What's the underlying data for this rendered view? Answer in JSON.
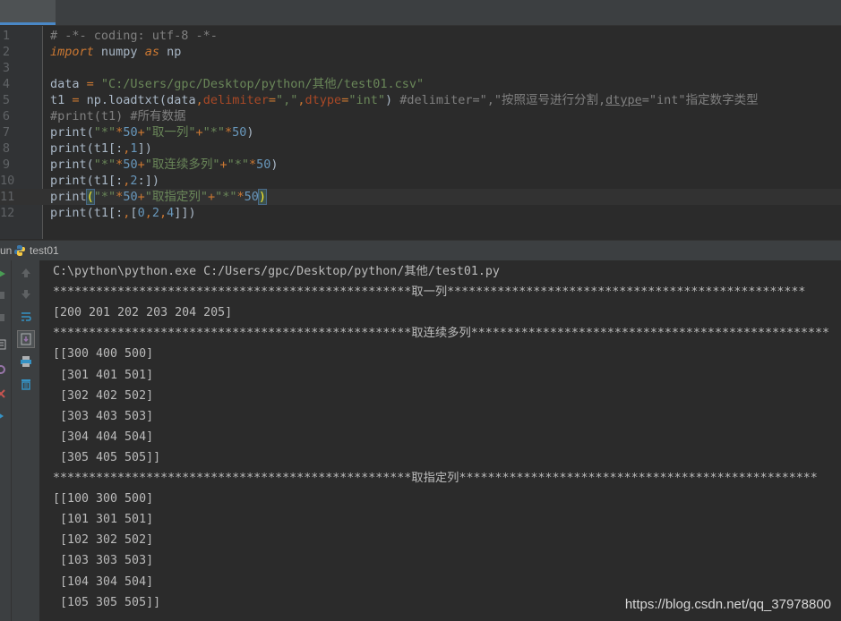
{
  "editor": {
    "lines": [
      {
        "n": "1",
        "segs": [
          {
            "c": "cm",
            "t": "# -*- coding: utf-8 -*-"
          }
        ]
      },
      {
        "n": "2",
        "segs": [
          {
            "c": "kw",
            "t": "import"
          },
          {
            "c": "fn",
            "t": " numpy "
          },
          {
            "c": "kw",
            "t": "as"
          },
          {
            "c": "fn",
            "t": " np"
          }
        ]
      },
      {
        "n": "3",
        "segs": []
      },
      {
        "n": "4",
        "segs": [
          {
            "c": "fn",
            "t": "data "
          },
          {
            "c": "op",
            "t": "="
          },
          {
            "c": "fn",
            "t": " "
          },
          {
            "c": "str",
            "t": "\"C:/Users/gpc/Desktop/python/其他/test01.csv\""
          }
        ]
      },
      {
        "n": "5",
        "segs": [
          {
            "c": "fn",
            "t": "t1 "
          },
          {
            "c": "op",
            "t": "="
          },
          {
            "c": "fn",
            "t": " np.loadtxt(data"
          },
          {
            "c": "op",
            "t": ","
          },
          {
            "c": "param",
            "t": "delimiter"
          },
          {
            "c": "op",
            "t": "="
          },
          {
            "c": "str",
            "t": "\",\""
          },
          {
            "c": "op",
            "t": ","
          },
          {
            "c": "param",
            "t": "dtype"
          },
          {
            "c": "op",
            "t": "="
          },
          {
            "c": "str",
            "t": "\"int\""
          },
          {
            "c": "fn",
            "t": ") "
          },
          {
            "c": "cm",
            "t": "#delimiter=\",\"按照逗号进行分割,"
          },
          {
            "c": "cm under",
            "t": "dtype"
          },
          {
            "c": "cm",
            "t": "=\"int\"指定数字类型"
          }
        ]
      },
      {
        "n": "6",
        "segs": [
          {
            "c": "cm",
            "t": "#print(t1) #所有数据"
          }
        ]
      },
      {
        "n": "7",
        "segs": [
          {
            "c": "fn",
            "t": "print("
          },
          {
            "c": "str",
            "t": "\"*\""
          },
          {
            "c": "op",
            "t": "*"
          },
          {
            "c": "num",
            "t": "50"
          },
          {
            "c": "op",
            "t": "+"
          },
          {
            "c": "str",
            "t": "\"取一列\""
          },
          {
            "c": "op",
            "t": "+"
          },
          {
            "c": "str",
            "t": "\"*\""
          },
          {
            "c": "op",
            "t": "*"
          },
          {
            "c": "num",
            "t": "50"
          },
          {
            "c": "fn",
            "t": ")"
          }
        ]
      },
      {
        "n": "8",
        "segs": [
          {
            "c": "fn",
            "t": "print(t1[:"
          },
          {
            "c": "op",
            "t": ","
          },
          {
            "c": "num",
            "t": "1"
          },
          {
            "c": "fn",
            "t": "])"
          }
        ]
      },
      {
        "n": "9",
        "segs": [
          {
            "c": "fn",
            "t": "print("
          },
          {
            "c": "str",
            "t": "\"*\""
          },
          {
            "c": "op",
            "t": "*"
          },
          {
            "c": "num",
            "t": "50"
          },
          {
            "c": "op",
            "t": "+"
          },
          {
            "c": "str",
            "t": "\"取连续多列\""
          },
          {
            "c": "op",
            "t": "+"
          },
          {
            "c": "str",
            "t": "\"*\""
          },
          {
            "c": "op",
            "t": "*"
          },
          {
            "c": "num",
            "t": "50"
          },
          {
            "c": "fn",
            "t": ")"
          }
        ]
      },
      {
        "n": "10",
        "segs": [
          {
            "c": "fn",
            "t": "print(t1[:"
          },
          {
            "c": "op",
            "t": ","
          },
          {
            "c": "num",
            "t": "2"
          },
          {
            "c": "fn",
            "t": ":])"
          }
        ]
      },
      {
        "n": "11",
        "current": true,
        "segs": [
          {
            "c": "fn",
            "t": "print"
          },
          {
            "c": "brk-hl",
            "t": "("
          },
          {
            "c": "str",
            "t": "\"*\""
          },
          {
            "c": "op",
            "t": "*"
          },
          {
            "c": "num",
            "t": "50"
          },
          {
            "c": "op",
            "t": "+"
          },
          {
            "c": "str",
            "t": "\"取指定列\""
          },
          {
            "c": "op",
            "t": "+"
          },
          {
            "c": "str",
            "t": "\"*\""
          },
          {
            "c": "op",
            "t": "*"
          },
          {
            "c": "num",
            "t": "50"
          },
          {
            "c": "brk-hl",
            "t": ")"
          }
        ]
      },
      {
        "n": "12",
        "segs": [
          {
            "c": "fn",
            "t": "print(t1[:"
          },
          {
            "c": "op",
            "t": ","
          },
          {
            "c": "fn",
            "t": "["
          },
          {
            "c": "num",
            "t": "0"
          },
          {
            "c": "op",
            "t": ","
          },
          {
            "c": "num",
            "t": "2"
          },
          {
            "c": "op",
            "t": ","
          },
          {
            "c": "num",
            "t": "4"
          },
          {
            "c": "fn",
            "t": "]])"
          }
        ]
      }
    ]
  },
  "run": {
    "label": "un",
    "config_name": "test01"
  },
  "console": {
    "lines": [
      "C:\\python\\python.exe C:/Users/gpc/Desktop/python/其他/test01.py",
      "**************************************************取一列**************************************************",
      "[200 201 202 203 204 205]",
      "**************************************************取连续多列**************************************************",
      "[[300 400 500]",
      " [301 401 501]",
      " [302 402 502]",
      " [303 403 503]",
      " [304 404 504]",
      " [305 405 505]]",
      "**************************************************取指定列**************************************************",
      "[[100 300 500]",
      " [101 301 501]",
      " [102 302 502]",
      " [103 303 503]",
      " [104 304 504]",
      " [105 305 505]]"
    ]
  },
  "watermark": "https://blog.csdn.net/qq_37978800",
  "colors": {
    "editor_bg": "#2b2b2b",
    "keyword": "#cc7832",
    "string": "#6a8759",
    "number": "#6897bb",
    "comment": "#808080",
    "param": "#aa4926",
    "console_text": "#bbbbbb"
  },
  "icons": {
    "run_tab": "python-icon",
    "left_toolbar": [
      "rerun-icon",
      "stop-icon",
      "pause-icon",
      "layout-icon",
      "pin-icon",
      "close-icon",
      "more-icon"
    ],
    "console_toolbar": [
      "scroll-up-icon",
      "scroll-down-icon",
      "soft-wrap-icon",
      "scroll-to-end-icon",
      "print-icon",
      "clear-icon"
    ]
  }
}
